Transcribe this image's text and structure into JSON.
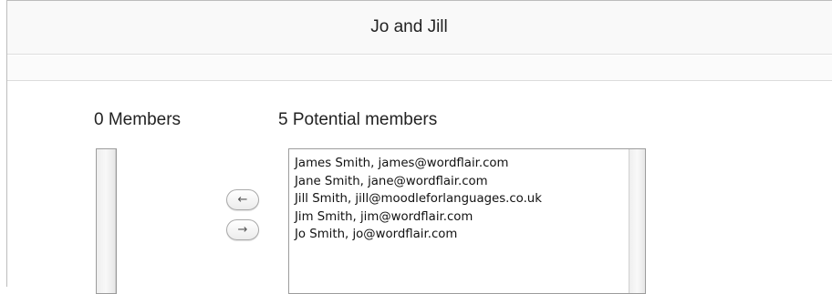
{
  "header": {
    "title": "Jo and Jill"
  },
  "members": {
    "heading": "0 Members",
    "items": []
  },
  "potential": {
    "heading": "5 Potential members",
    "items": [
      "James Smith, james@wordflair.com",
      "Jane Smith, jane@wordflair.com",
      "Jill Smith, jill@moodleforlanguages.co.uk",
      "Jim Smith, jim@wordflair.com",
      "Jo Smith, jo@wordflair.com"
    ]
  },
  "buttons": {
    "add_glyph": "←",
    "remove_glyph": "→"
  },
  "icons": {
    "add": "left-arrow-icon",
    "remove": "right-arrow-icon"
  }
}
